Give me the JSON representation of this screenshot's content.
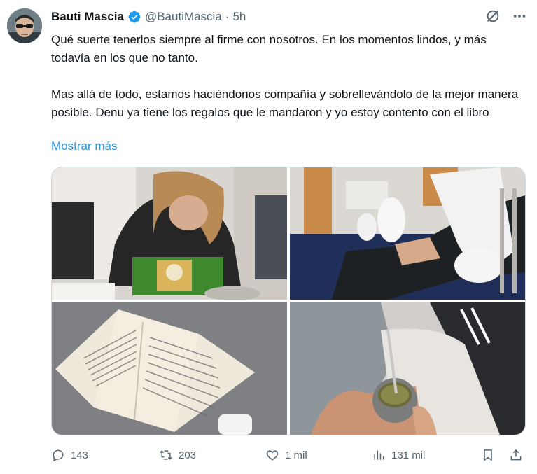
{
  "author": {
    "display_name": "Bauti Mascia",
    "handle": "@BautiMascia",
    "separator": "·",
    "time": "5h",
    "verified_color": "#1d9bf0"
  },
  "tweet": {
    "paragraph1": "Qué suerte tenerlos siempre al firme con nosotros. En los momentos lindos, y más todavía en los que no tanto.",
    "paragraph2": "Mas allá de todo, estamos haciéndonos compañía y sobrellevándolo de la mejor manera posible. Denu ya tiene los regalos que le mandaron y yo estoy contento con el libro",
    "show_more": "Mostrar más"
  },
  "media": [
    {
      "icon": "photo-woman-drawing"
    },
    {
      "icon": "photo-feet-hospital-bed"
    },
    {
      "icon": "photo-open-book"
    },
    {
      "icon": "photo-mate-gourd"
    }
  ],
  "actions": {
    "replies": "143",
    "retweets": "203",
    "likes": "1 mil",
    "views": "131 mil"
  },
  "colors": {
    "text": "#0f1419",
    "secondary": "#536471",
    "link": "#1d9bf0"
  }
}
